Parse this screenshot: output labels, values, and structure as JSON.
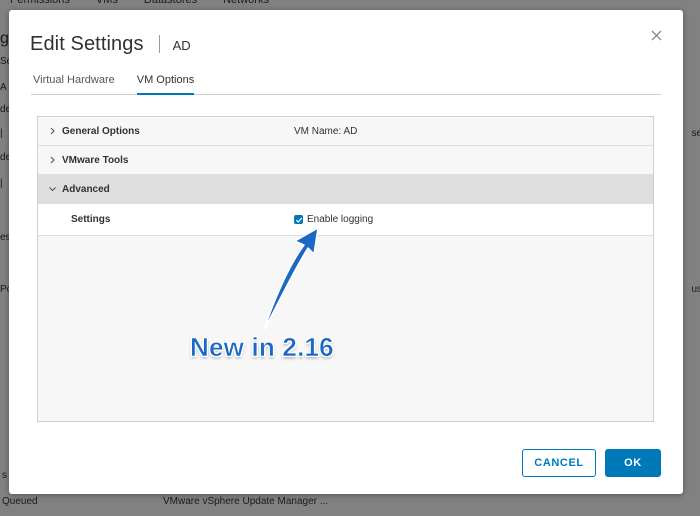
{
  "background": {
    "tabs": [
      "Permissions",
      "VMs",
      "Datastores",
      "Networks"
    ],
    "left_fragments": [
      "ge",
      "So",
      "A",
      "de",
      "|",
      "de",
      "|",
      "es",
      "Po"
    ],
    "right_fragments": [
      "se",
      "us"
    ],
    "bottom_fragments": [
      "s",
      "Queued",
      "VMware vSphere Update Manager ..."
    ]
  },
  "dialog": {
    "title": "Edit Settings",
    "vm_name": "AD",
    "close_icon": "close-icon",
    "tabs": [
      {
        "label": "Virtual Hardware",
        "active": false
      },
      {
        "label": "VM Options",
        "active": true
      }
    ],
    "sections": [
      {
        "label": "General Options",
        "value": "VM Name: AD",
        "expanded": false
      },
      {
        "label": "VMware Tools",
        "value": "",
        "expanded": false
      },
      {
        "label": "Advanced",
        "value": "",
        "expanded": true
      }
    ],
    "settings_row": {
      "label": "Settings",
      "checkbox_label": "Enable logging",
      "checked": true
    },
    "buttons": {
      "cancel": "CANCEL",
      "ok": "OK"
    }
  },
  "annotation": {
    "text": "New in 2.16"
  },
  "colors": {
    "accent": "#0079b8",
    "annotation": "#1c68c2",
    "advanced_row": "#dedede"
  }
}
